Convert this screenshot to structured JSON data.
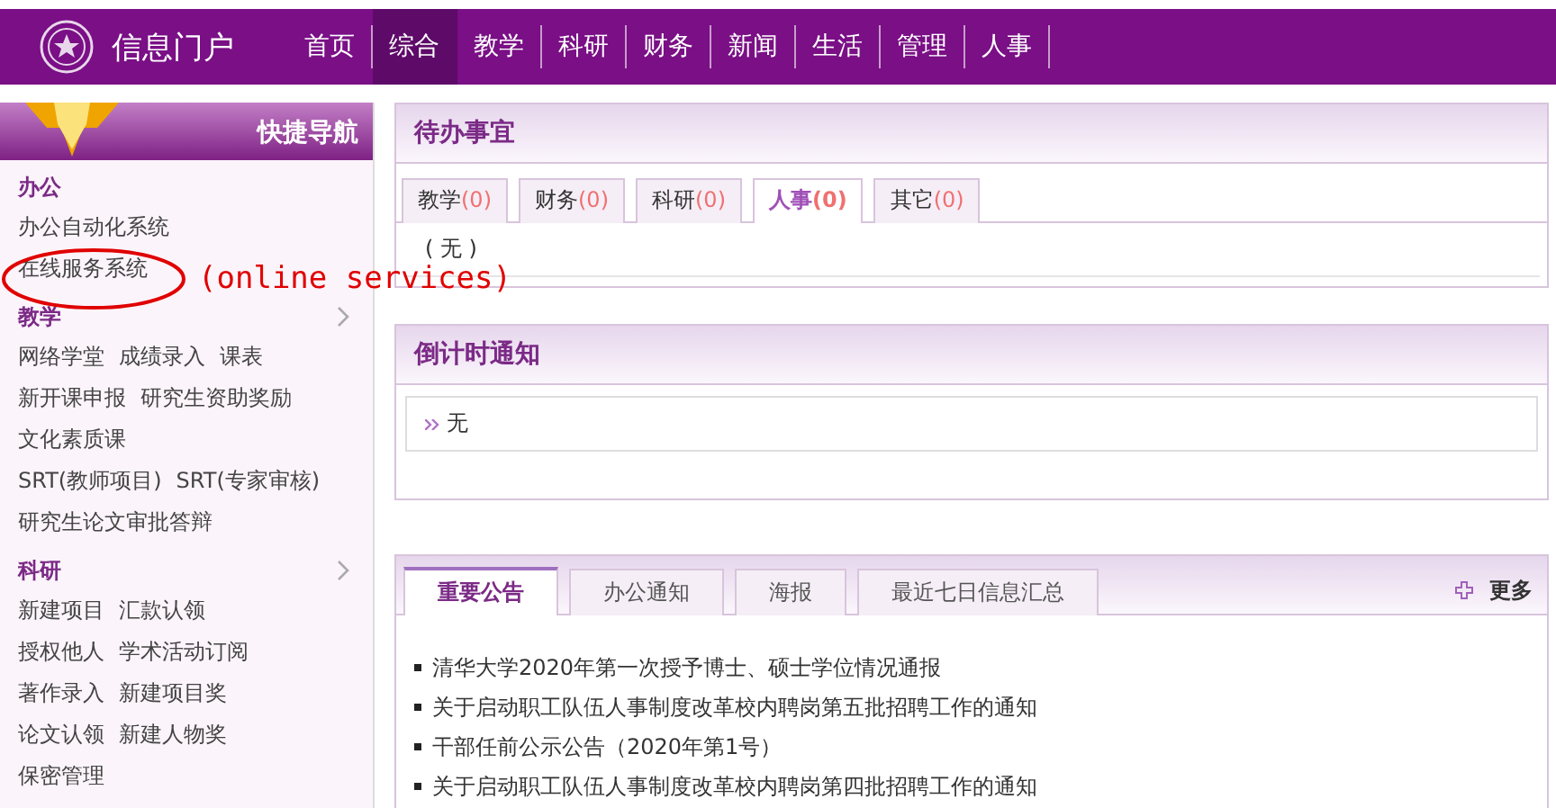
{
  "header": {
    "title": "信息门户",
    "nav": [
      {
        "label": "首页",
        "selected": false
      },
      {
        "label": "综合",
        "selected": true
      },
      {
        "label": "教学",
        "selected": false
      },
      {
        "label": "科研",
        "selected": false
      },
      {
        "label": "财务",
        "selected": false
      },
      {
        "label": "新闻",
        "selected": false
      },
      {
        "label": "生活",
        "selected": false
      },
      {
        "label": "管理",
        "selected": false
      },
      {
        "label": "人事",
        "selected": false
      }
    ]
  },
  "sidebar": {
    "title": "快捷导航",
    "sections": [
      {
        "title": "办公",
        "expandable": false,
        "rows": [
          [
            "办公自动化系统"
          ],
          [
            "在线服务系统"
          ]
        ]
      },
      {
        "title": "教学",
        "expandable": true,
        "rows": [
          [
            "网络学堂",
            "成绩录入",
            "课表"
          ],
          [
            "新开课申报",
            "研究生资助奖励"
          ],
          [
            "文化素质课"
          ],
          [
            "SRT(教师项目)",
            "SRT(专家审核)"
          ],
          [
            "研究生论文审批答辩"
          ]
        ]
      },
      {
        "title": "科研",
        "expandable": true,
        "rows": [
          [
            "新建项目",
            "汇款认领"
          ],
          [
            "授权他人",
            "学术活动订阅"
          ],
          [
            "著作录入",
            "新建项目奖"
          ],
          [
            "论文认领",
            "新建人物奖"
          ],
          [
            "保密管理"
          ]
        ]
      }
    ]
  },
  "annotation": {
    "text": "(online services)"
  },
  "todo": {
    "title": "待办事宜",
    "tabs": [
      {
        "label": "教学",
        "count": "(0)",
        "selected": false
      },
      {
        "label": "财务",
        "count": "(0)",
        "selected": false
      },
      {
        "label": "科研",
        "count": "(0)",
        "selected": false
      },
      {
        "label": "人事",
        "count": "(0)",
        "selected": true
      },
      {
        "label": "其它",
        "count": "(0)",
        "selected": false
      }
    ],
    "content": "( 无 )"
  },
  "countdown": {
    "title": "倒计时通知",
    "items": [
      "无"
    ]
  },
  "notices": {
    "tabs": [
      {
        "label": "重要公告",
        "selected": true
      },
      {
        "label": "办公通知",
        "selected": false
      },
      {
        "label": "海报",
        "selected": false
      },
      {
        "label": "最近七日信息汇总",
        "selected": false
      }
    ],
    "more": "更多",
    "items": [
      "清华大学2020年第一次授予博士、硕士学位情况通报",
      "关于启动职工队伍人事制度改革校内聘岗第五批招聘工作的通知",
      "干部任前公示公告（2020年第1号）",
      "关于启动职工队伍人事制度改革校内聘岗第四批招聘工作的通知"
    ]
  }
}
